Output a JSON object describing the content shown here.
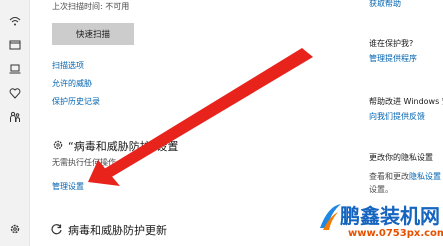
{
  "scan": {
    "last_scan_label": "上次扫描时间: 不可用",
    "quick_scan_button": "快速扫描"
  },
  "links": {
    "scan_options": "扫描选项",
    "allowed_threats": "允许的威胁",
    "protection_history": "保护历史记录"
  },
  "settings_section": {
    "title": "“病毒和威胁防护”设置",
    "status": "无需执行任何操作。",
    "manage_link": "管理设置"
  },
  "updates_section": {
    "title": "病毒和威胁防护更新"
  },
  "right_panel": {
    "get_help": "获取帮助",
    "who_protects": "谁在保护我?",
    "manage_providers": "管理提供程序",
    "help_improve": "帮助改进 Windows 安全中心",
    "give_feedback": "向我们提供反馈",
    "change_privacy": "更改你的隐私设置",
    "privacy_line1": "查看和更改",
    "privacy_line2": "设置。",
    "privacy_link": "隐私设置"
  },
  "watermark": {
    "brand": "鹏鑫装机网",
    "url": "www.0753px.com"
  },
  "colors": {
    "link": "#0063b1",
    "arrow": "#e8231c",
    "sidebar_bg": "#f2f2f2",
    "button_bg": "#cccccc"
  },
  "icons": [
    "wifi-icon",
    "browser-icon",
    "laptop-icon",
    "heart-icon",
    "family-icon",
    "gear-icon",
    "shield-icon",
    "refresh-icon"
  ]
}
